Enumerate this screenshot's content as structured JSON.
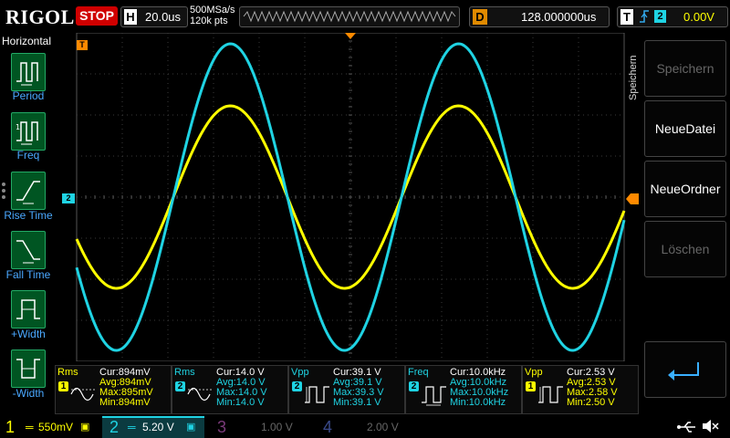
{
  "topbar": {
    "logo": "RIGOL",
    "run_state": "STOP",
    "horizontal_label": "H",
    "timebase": "20.0us",
    "sample_rate": "500MSa/s",
    "memory_depth": "120k pts",
    "delay_label": "D",
    "delay_value": "128.000000us",
    "trigger_label": "T",
    "trigger_slope": "rising-edge-icon",
    "trigger_source": "2",
    "trigger_level": "0.00V"
  },
  "left_menu": {
    "title": "Horizontal",
    "items": [
      {
        "label": "Period",
        "icon": "period-icon"
      },
      {
        "label": "Freq",
        "icon": "freq-icon"
      },
      {
        "label": "Rise Time",
        "icon": "rise-time-icon"
      },
      {
        "label": "Fall Time",
        "icon": "fall-time-icon"
      },
      {
        "label": "+Width",
        "icon": "pos-width-icon"
      },
      {
        "label": "-Width",
        "icon": "neg-width-icon"
      }
    ]
  },
  "right_menu": {
    "title": "Speichern",
    "items": [
      {
        "label": "Speichern",
        "enabled": false
      },
      {
        "label": "NeueDatei",
        "enabled": true
      },
      {
        "label": "NeueOrdner",
        "enabled": true
      },
      {
        "label": "Löschen",
        "enabled": false
      },
      {
        "label": "",
        "icon": "enter-icon",
        "enabled": true
      }
    ]
  },
  "markers": {
    "trigger_marker": "T",
    "ch2_marker": "2"
  },
  "measurements": [
    {
      "name": "Rms",
      "channel": "1",
      "cur": "Cur:894mV",
      "avg": "Avg:894mV",
      "max": "Max:895mV",
      "min": "Min:894mV",
      "icon": "sine-rms-icon"
    },
    {
      "name": "Rms",
      "channel": "2",
      "cur": "Cur:14.0 V",
      "avg": "Avg:14.0 V",
      "max": "Max:14.0 V",
      "min": "Min:14.0 V",
      "icon": "sine-rms-icon"
    },
    {
      "name": "Vpp",
      "channel": "2",
      "cur": "Cur:39.1 V",
      "avg": "Avg:39.1 V",
      "max": "Max:39.3 V",
      "min": "Min:39.1 V",
      "icon": "vpp-icon"
    },
    {
      "name": "Freq",
      "channel": "2",
      "cur": "Cur:10.0kHz",
      "avg": "Avg:10.0kHz",
      "max": "Max:10.0kHz",
      "min": "Min:10.0kHz",
      "icon": "freq-icon"
    },
    {
      "name": "Vpp",
      "channel": "1",
      "cur": "Cur:2.53 V",
      "avg": "Avg:2.53 V",
      "max": "Max:2.58 V",
      "min": "Min:2.50 V",
      "icon": "vpp-icon"
    }
  ],
  "channels": [
    {
      "num": "1",
      "scale": "550mV",
      "active": true
    },
    {
      "num": "2",
      "scale": "5.20 V",
      "active": true
    },
    {
      "num": "3",
      "scale": "1.00 V",
      "active": false
    },
    {
      "num": "4",
      "scale": "2.00 V",
      "active": false
    }
  ],
  "status_icons": [
    "usb-icon",
    "speaker-muted-icon"
  ],
  "colors": {
    "ch1": "#ffff00",
    "ch2": "#1fd3e3",
    "ch3": "#c040c0",
    "ch4": "#4060ff",
    "trigger": "#ff8a00",
    "stop": "#d00000"
  }
}
